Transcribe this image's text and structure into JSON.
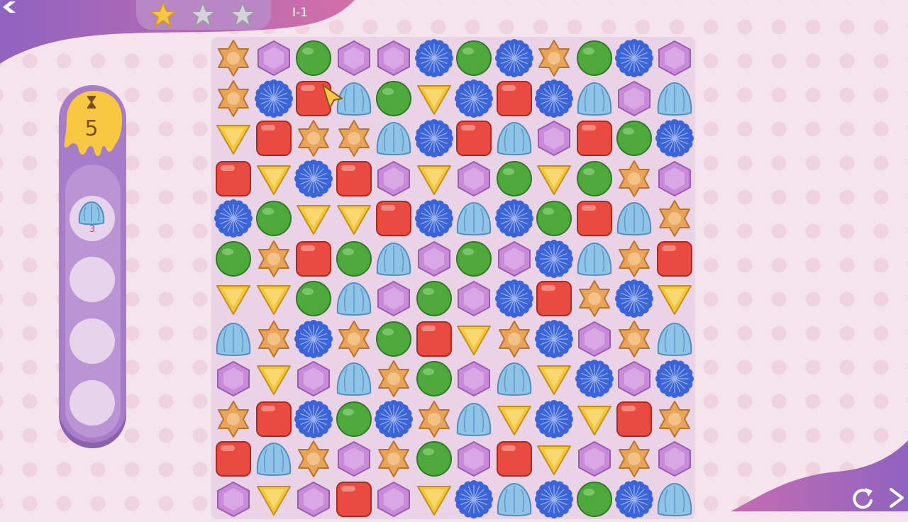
{
  "header": {
    "level_label": "I-1",
    "stars": [
      "gold",
      "silver",
      "silver"
    ]
  },
  "moves": {
    "count": "5",
    "icon": "hourglass-icon"
  },
  "goals": [
    {
      "piece": "blue-jelly",
      "count": "3"
    },
    {
      "piece": "",
      "count": ""
    },
    {
      "piece": "",
      "count": ""
    },
    {
      "piece": "",
      "count": ""
    }
  ],
  "colors": {
    "background": "#f5e4ec",
    "banner_purple": "#9b6fc4",
    "panel_purple": "#a77cc9",
    "moves_yellow": "#f7c842",
    "star_gold": "#f6c846",
    "red": "#e94b40",
    "green": "#4ea83c",
    "blue_flower": "#3b64d8",
    "light_blue": "#8fc4e6",
    "purple_hex": "#c98ad9",
    "orange_star": "#e8a55a",
    "yellow_triangle": "#f4c63a"
  },
  "board": {
    "rows": [
      [
        "star",
        "hex",
        "circle",
        "hex",
        "hex",
        "flower",
        "circle",
        "flower",
        "star",
        "circle",
        "flower",
        "hex"
      ],
      [
        "star",
        "flower",
        "square",
        "jelly",
        "circle",
        "tri",
        "flower",
        "square",
        "flower",
        "jelly",
        "hex",
        "jelly"
      ],
      [
        "tri",
        "square",
        "star",
        "star",
        "jelly",
        "flower",
        "square",
        "jelly",
        "hex",
        "square",
        "circle",
        "flower"
      ],
      [
        "square",
        "tri",
        "flower",
        "square",
        "hex",
        "tri",
        "hex",
        "circle",
        "tri",
        "circle",
        "star",
        "hex"
      ],
      [
        "flower",
        "circle",
        "tri",
        "tri",
        "square",
        "flower",
        "jelly",
        "flower",
        "circle",
        "square",
        "jelly",
        "star"
      ],
      [
        "circle",
        "star",
        "square",
        "circle",
        "jelly",
        "hex",
        "circle",
        "hex",
        "flower",
        "jelly",
        "star",
        "square"
      ],
      [
        "tri",
        "tri",
        "circle",
        "jelly",
        "hex",
        "circle",
        "hex",
        "flower",
        "square",
        "star",
        "flower",
        "tri"
      ],
      [
        "jelly",
        "star",
        "flower",
        "star",
        "circle",
        "square",
        "tri",
        "star",
        "flower",
        "hex",
        "star",
        "jelly"
      ],
      [
        "hex",
        "tri",
        "hex",
        "jelly",
        "star",
        "circle",
        "hex",
        "jelly",
        "tri",
        "flower",
        "hex",
        "flower"
      ],
      [
        "star",
        "square",
        "flower",
        "circle",
        "flower",
        "star",
        "jelly",
        "tri",
        "flower",
        "tri",
        "square",
        "star"
      ],
      [
        "square",
        "jelly",
        "star",
        "hex",
        "star",
        "circle",
        "hex",
        "square",
        "tri",
        "hex",
        "star",
        "hex"
      ],
      [
        "hex",
        "tri",
        "hex",
        "square",
        "hex",
        "tri",
        "flower",
        "jelly",
        "flower",
        "circle",
        "flower",
        "jelly"
      ]
    ]
  },
  "controls": {
    "back": "back-icon",
    "restart": "restart-icon",
    "next": "next-arrow-icon"
  }
}
